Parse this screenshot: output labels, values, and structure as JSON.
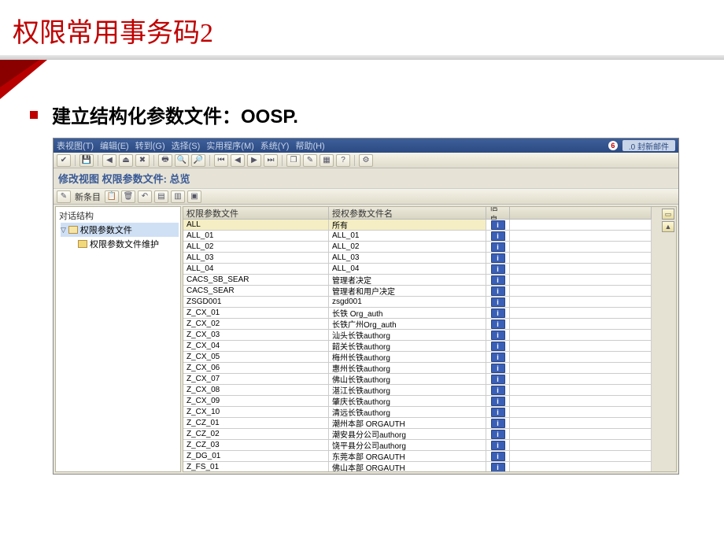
{
  "slide": {
    "title": "权限常用事务码2",
    "bullet": "建立结构化参数文件：OOSP."
  },
  "sap": {
    "menu": {
      "items": [
        "表视图(T)",
        "编辑(E)",
        "转到(G)",
        "选择(S)",
        "实用程序(M)",
        "系统(Y)",
        "帮助(H)"
      ],
      "notify_badge": "6",
      "right_text": ".0 封新邮件"
    },
    "subtitle": "修改视图 权限参数文件: 总览",
    "toolbar2": {
      "new_label": "新条目",
      "icon_check": "✔",
      "icon_pencil": "✎"
    },
    "tree": {
      "title": "对话结构",
      "node_root": "权限参数文件",
      "node_child": "权限参数文件维护"
    },
    "table": {
      "headers": {
        "c1": "权限参数文件",
        "c2": "授权参数文件名",
        "c3": "信息"
      },
      "rows": [
        {
          "c1": "ALL",
          "c2": "所有",
          "hl": true
        },
        {
          "c1": "ALL_01",
          "c2": "ALL_01"
        },
        {
          "c1": "ALL_02",
          "c2": "ALL_02"
        },
        {
          "c1": "ALL_03",
          "c2": "ALL_03"
        },
        {
          "c1": "ALL_04",
          "c2": "ALL_04"
        },
        {
          "c1": "CACS_SB_SEAR",
          "c2": "管理者决定"
        },
        {
          "c1": "CACS_SEAR",
          "c2": "管理者和用户决定"
        },
        {
          "c1": "ZSGD001",
          "c2": "zsgd001"
        },
        {
          "c1": "Z_CX_01",
          "c2": "长铁 Org_auth"
        },
        {
          "c1": "Z_CX_02",
          "c2": "长铁广州Org_auth"
        },
        {
          "c1": "Z_CX_03",
          "c2": "汕头长铁authorg"
        },
        {
          "c1": "Z_CX_04",
          "c2": "韶关长铁authorg"
        },
        {
          "c1": "Z_CX_05",
          "c2": "梅州长铁authorg"
        },
        {
          "c1": "Z_CX_06",
          "c2": "惠州长铁authorg"
        },
        {
          "c1": "Z_CX_07",
          "c2": "佛山长铁authorg"
        },
        {
          "c1": "Z_CX_08",
          "c2": "湛江长铁authorg"
        },
        {
          "c1": "Z_CX_09",
          "c2": "肇庆长铁authorg"
        },
        {
          "c1": "Z_CX_10",
          "c2": "清远长铁authorg"
        },
        {
          "c1": "Z_CZ_01",
          "c2": "潮州本部 ORGAUTH"
        },
        {
          "c1": "Z_CZ_02",
          "c2": "潮安县分公司authorg"
        },
        {
          "c1": "Z_CZ_03",
          "c2": "饶平县分公司authorg"
        },
        {
          "c1": "Z_DG_01",
          "c2": "东莞本部 ORGAUTH"
        },
        {
          "c1": "Z_FS_01",
          "c2": "佛山本部 ORGAUTH"
        }
      ],
      "info_label": "i"
    }
  }
}
